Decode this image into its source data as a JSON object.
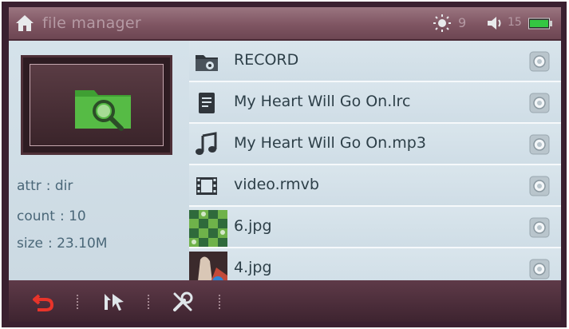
{
  "statusbar": {
    "title": "file manager",
    "brightness_value": "9",
    "volume_value": "15",
    "icons": [
      "home-icon",
      "brightness-icon",
      "volume-icon",
      "battery-icon"
    ]
  },
  "info": {
    "attr_label": "attr",
    "attr_value": ": dir",
    "count_label": "count",
    "count_value": ": 10",
    "size_label": "size",
    "size_value": ": 23.10M"
  },
  "files": [
    {
      "name": "RECORD",
      "icon": "record-folder-icon"
    },
    {
      "name": "My Heart Will Go On.lrc",
      "icon": "document-icon"
    },
    {
      "name": "My Heart Will Go On.mp3",
      "icon": "music-note-icon"
    },
    {
      "name": "video.rmvb",
      "icon": "film-icon"
    },
    {
      "name": "6.jpg",
      "icon": "image-thumbnail"
    },
    {
      "name": "4.jpg",
      "icon": "image-thumbnail"
    }
  ],
  "toolbar": {
    "icons": [
      "back-icon",
      "select-icon",
      "tools-icon"
    ]
  },
  "colors": {
    "statusbar": "#7f5562",
    "panel": "#d5e2ea",
    "text": "#2d3f48",
    "accent_red": "#e8342a",
    "folder_green": "#4cae3a"
  }
}
